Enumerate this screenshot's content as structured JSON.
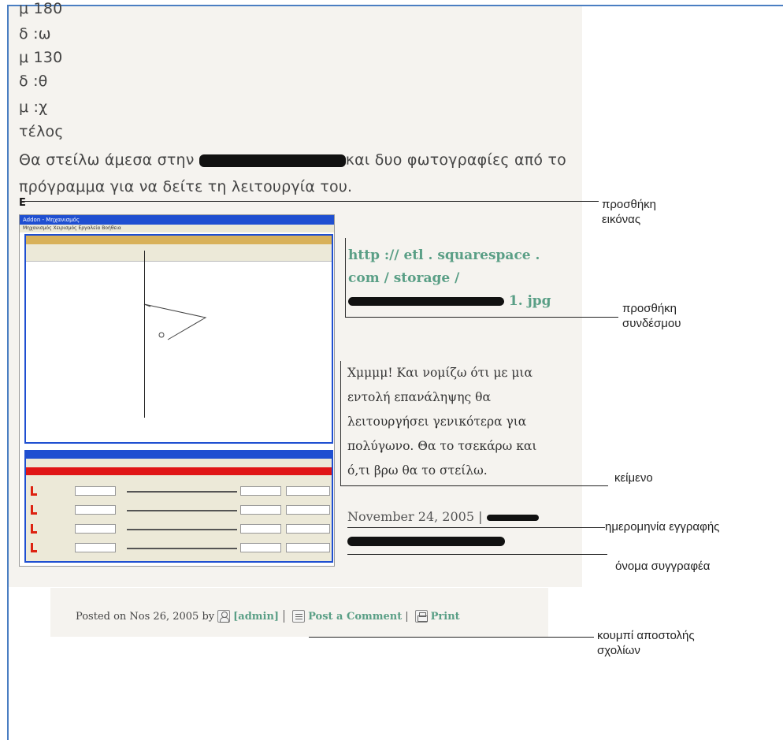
{
  "post": {
    "lines": [
      "μ 180",
      "δ :ω",
      "μ 130",
      "δ :θ",
      "μ :χ",
      "τέλος"
    ],
    "para1_start": "Θα στείλω άμεσα στην",
    "para1_end": "και δυο φωτογραφίες από το",
    "para2": "πρόγραμμα για να δείτε τη λειτουργία του.",
    "image_marker": "E"
  },
  "screenshot": {
    "window_title": "Addon - Μηχανισμός",
    "menu": "Μηχανισμός  Χειρισμός  Εργαλεία  Βοήθεια"
  },
  "side": {
    "link_text": "http :// etl . squarespace . com / storage / chrysanthopoulos 1. jpg",
    "link_line1": "http :// etl . squarespace .",
    "link_line2": "com / storage /",
    "link_line3_end": "1. jpg",
    "body_lines": [
      "Χμμμμ! Και νομίζω ότι με μια",
      "εντολή επανάληψης θα",
      "λειτουργήσει γενικότερα για",
      "πολύγωνο. Θα το τσεκάρω και",
      "ό,τι βρω θα το στείλω."
    ],
    "date": "November 24, 2005 |"
  },
  "annotations": {
    "add_image": [
      "προσθήκη",
      "εικόνας"
    ],
    "add_link": [
      "προσθήκη",
      "συνδέσμου"
    ],
    "text": "κείμενο",
    "date": "ημερομηνία εγγραφής",
    "author": "όνομα συγγραφέα",
    "comment_button": [
      "κουμπί αποστολής",
      "σχολίων"
    ]
  },
  "footer": {
    "posted_on": "Posted on Nos 26, 2005 by",
    "author_link": "[admin]",
    "comment_link": "Post a Comment",
    "divider": "|",
    "print_link": "Print"
  },
  "colors": {
    "link_green": "#5a9f86",
    "frame_blue": "#4a7ec2",
    "page_background": "#f5f3ef"
  }
}
